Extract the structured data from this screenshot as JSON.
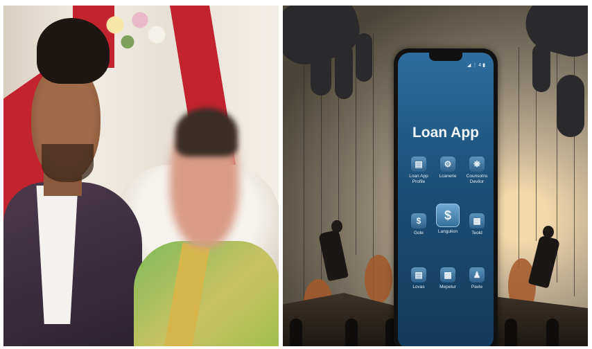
{
  "left_photo": {
    "description_icon": "wedding-couple-photo"
  },
  "right_illustration": {
    "app_title": "Loan App",
    "status_bar": "◢ ⋮ 4 ▮",
    "icons": [
      {
        "label": "Loan App\nProfile",
        "icon": "document-icon"
      },
      {
        "label": "Lcanerie",
        "icon": "gear-icon"
      },
      {
        "label": "Counsolns\nDevilor",
        "icon": "cog-icon"
      },
      {
        "label": "Gote",
        "icon": "shield-dollar-icon"
      },
      {
        "label": "Langulion",
        "icon": "house-dollar-icon"
      },
      {
        "label": "Teold",
        "icon": "calendar-icon"
      },
      {
        "label": "Lovas",
        "icon": "document-icon"
      },
      {
        "label": "Mepetur",
        "icon": "chart-icon"
      },
      {
        "label": "Pavle",
        "icon": "person-icon"
      }
    ],
    "colors": {
      "screen_top": "#2e6d9e",
      "screen_bottom": "#133a5a",
      "drape_red": "#c3232e"
    }
  }
}
